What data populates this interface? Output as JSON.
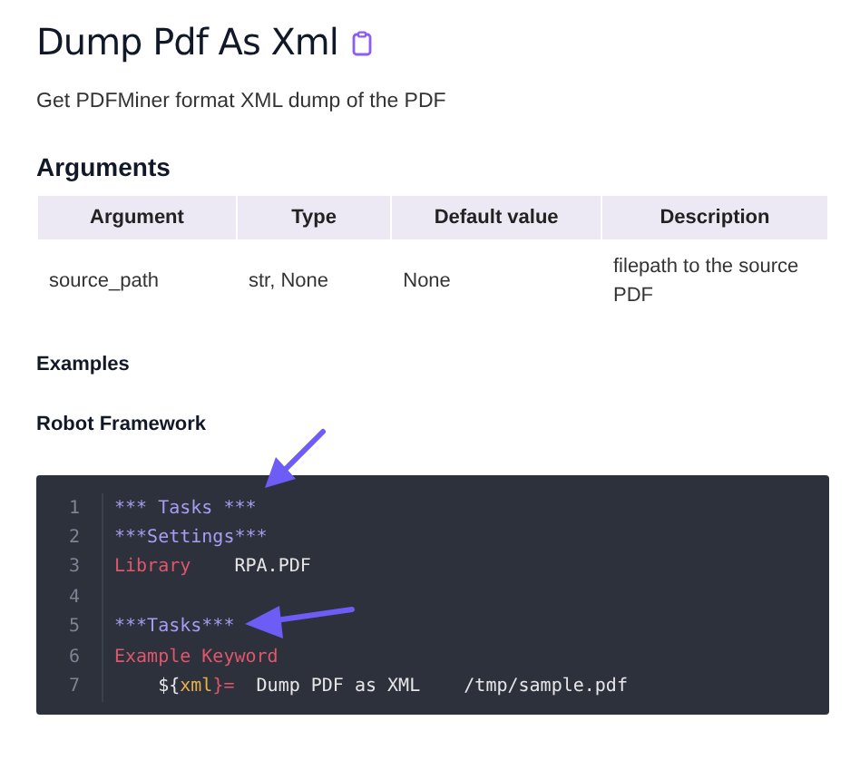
{
  "title": "Dump Pdf As Xml",
  "description": "Get PDFMiner format XML dump of the PDF",
  "arguments_heading": "Arguments",
  "table": {
    "columns": [
      "Argument",
      "Type",
      "Default value",
      "Description"
    ],
    "rows": [
      [
        "source_path",
        "str, None",
        "None",
        "filepath to the source PDF"
      ]
    ]
  },
  "examples_heading": "Examples",
  "example_title": "Robot Framework",
  "code": {
    "lines": [
      {
        "number": "1",
        "tokens": [
          {
            "kind": "heading",
            "text": "*** Tasks ***"
          }
        ]
      },
      {
        "number": "2",
        "tokens": [
          {
            "kind": "heading",
            "text": "***Settings***"
          }
        ]
      },
      {
        "number": "3",
        "tokens": [
          {
            "kind": "keyword",
            "text": "Library"
          },
          {
            "kind": "plain",
            "text": "    RPA.PDF"
          }
        ]
      },
      {
        "number": "4"
      },
      {
        "number": "5",
        "tokens": [
          {
            "kind": "heading",
            "text": "***Tasks***"
          }
        ]
      },
      {
        "number": "6",
        "tokens": [
          {
            "kind": "keyword",
            "text": "Example Keyword"
          }
        ]
      },
      {
        "number": "7",
        "tokens": [
          {
            "kind": "plain",
            "text": "    ${"
          },
          {
            "kind": "variable",
            "text": "xml"
          },
          {
            "kind": "keyword",
            "text": "}="
          },
          {
            "kind": "plain",
            "text": "  Dump PDF as XML    /tmp/sample.pdf"
          }
        ]
      }
    ]
  }
}
